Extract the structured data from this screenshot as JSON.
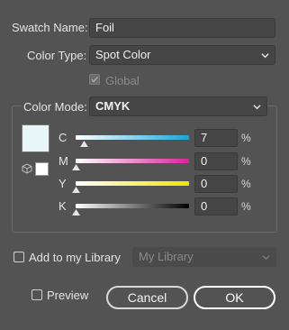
{
  "swatch_name": {
    "label": "Swatch Name:",
    "value": "Foil"
  },
  "color_type": {
    "label": "Color Type:",
    "value": "Spot Color"
  },
  "global": {
    "label": "Global",
    "checked": true,
    "enabled": false
  },
  "color_mode": {
    "label": "Color Mode:",
    "value": "CMYK"
  },
  "swatch_preview_color": "#e9f6f9",
  "sliders": [
    {
      "letter": "C",
      "value": "7",
      "unit": "%",
      "fraction": 0.07
    },
    {
      "letter": "M",
      "value": "0",
      "unit": "%",
      "fraction": 0.0
    },
    {
      "letter": "Y",
      "value": "0",
      "unit": "%",
      "fraction": 0.0
    },
    {
      "letter": "K",
      "value": "0",
      "unit": "%",
      "fraction": 0.0
    }
  ],
  "library": {
    "label": "Add to my Library",
    "checked": false,
    "dropdown_value": "My Library"
  },
  "preview": {
    "label": "Preview",
    "checked": false
  },
  "buttons": {
    "cancel": "Cancel",
    "ok": "OK"
  },
  "colors": {
    "background": "#535353",
    "field": "#454545",
    "cyan": "#1aa6d6",
    "magenta": "#d8239a",
    "yellow": "#f1e600",
    "black": "#000000"
  }
}
